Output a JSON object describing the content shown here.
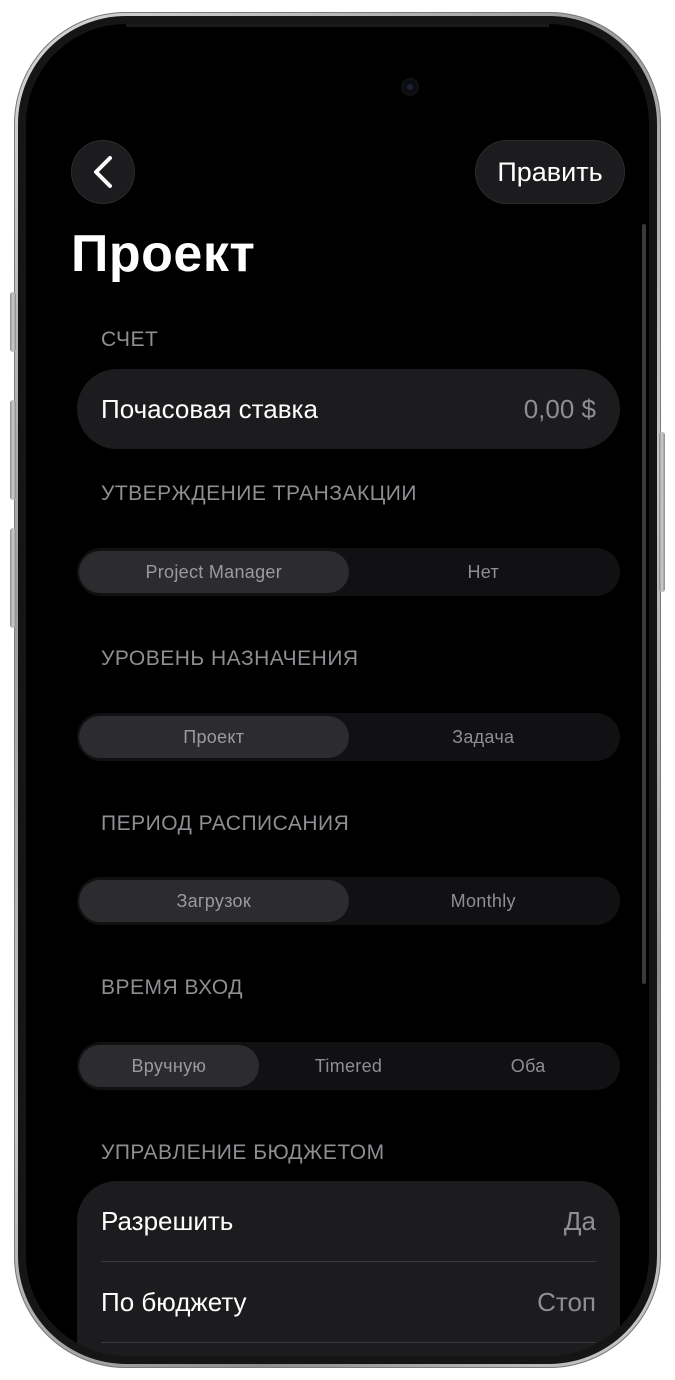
{
  "header": {
    "back_icon": "chevron-left-icon",
    "edit_label": "Править",
    "title": "Проект"
  },
  "sections": {
    "billing": {
      "header": "СЧЕТ",
      "hourly_rate_label": "Почасовая ставка",
      "hourly_rate_value": "0,00 $"
    },
    "approval": {
      "header": "УТВЕРЖДЕНИЕ ТРАНЗАКЦИИ",
      "options": [
        "Project Manager",
        "Нет"
      ],
      "selected": "Project Manager"
    },
    "assignment_level": {
      "header": "УРОВЕНЬ НАЗНАЧЕНИЯ",
      "options": [
        "Проект",
        "Задача"
      ],
      "selected": "Проект"
    },
    "schedule_period": {
      "header": "ПЕРИОД РАСПИСАНИЯ",
      "options": [
        "Загрузок",
        "Monthly"
      ],
      "selected": "Загрузок"
    },
    "time_entry": {
      "header": "ВРЕМЯ ВХОД",
      "options": [
        "Вручную",
        "Timered",
        "Оба"
      ],
      "selected": "Вручную"
    },
    "budget": {
      "header": "УПРАВЛЕНИЕ БЮДЖЕТОМ",
      "allow_label": "Разрешить",
      "allow_value": "Да",
      "by_budget_label": "По бюджету",
      "by_budget_value": "Стоп"
    }
  },
  "colors": {
    "background": "#000000",
    "card": "#1c1c1e",
    "secondary_text": "#8e8e93",
    "segment_selected": "#2c2c2e"
  }
}
